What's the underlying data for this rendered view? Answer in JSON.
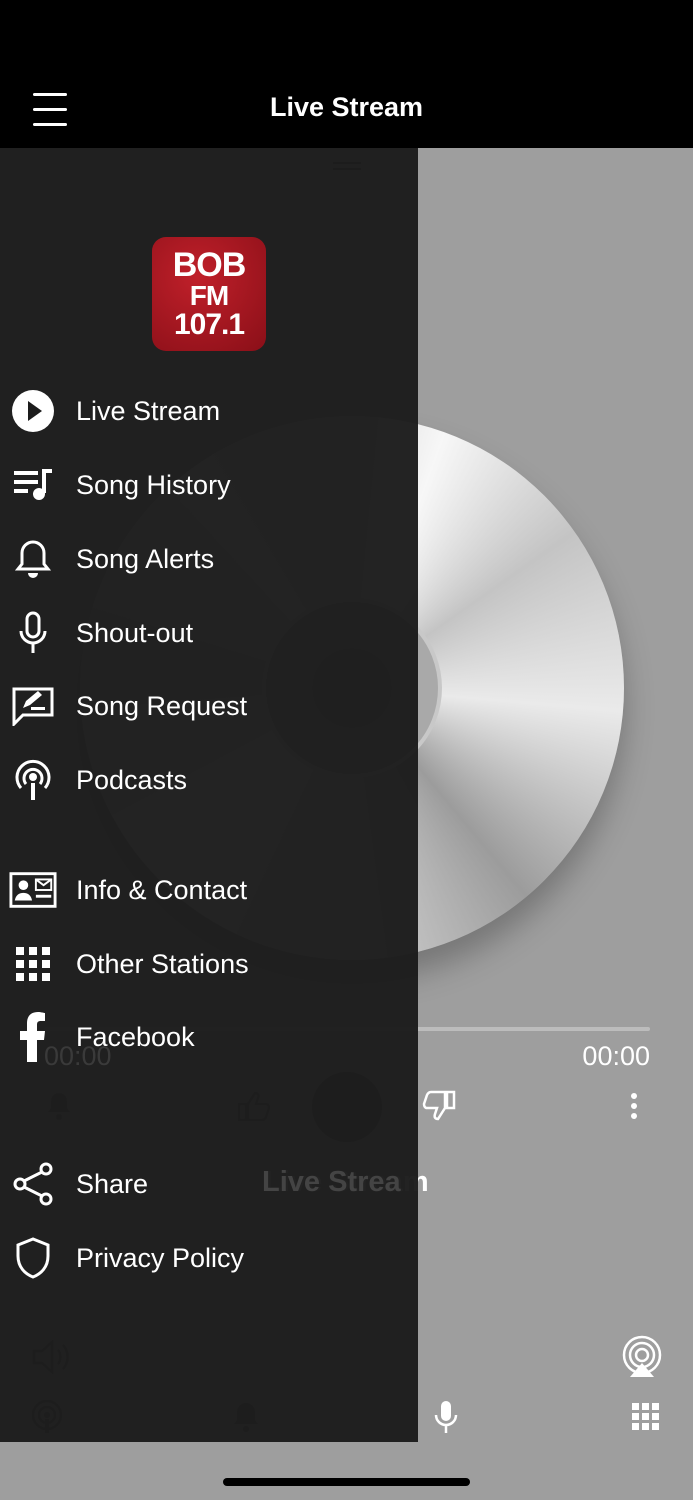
{
  "header": {
    "title": "Live Stream"
  },
  "player": {
    "elapsed": "00:00",
    "duration": "00:00",
    "title": "Live Stream",
    "progress": 0
  },
  "drawer": {
    "logo": {
      "line1": "BOB",
      "line2": "FM",
      "line3": "107.1"
    },
    "items": [
      {
        "label": "Live Stream",
        "icon": "play-circle-icon"
      },
      {
        "label": "Song History",
        "icon": "playlist-icon"
      },
      {
        "label": "Song Alerts",
        "icon": "bell-icon"
      },
      {
        "label": "Shout-out",
        "icon": "microphone-icon"
      },
      {
        "label": "Song Request",
        "icon": "request-icon"
      },
      {
        "label": "Podcasts",
        "icon": "podcast-icon"
      },
      {
        "label": "Info & Contact",
        "icon": "contact-card-icon"
      },
      {
        "label": "Other Stations",
        "icon": "grid-icon"
      },
      {
        "label": "Facebook",
        "icon": "facebook-icon"
      },
      {
        "label": "Share",
        "icon": "share-icon"
      },
      {
        "label": "Privacy Policy",
        "icon": "shield-icon"
      }
    ]
  },
  "colors": {
    "header_bg": "#000000",
    "drawer_bg": "#1c1c1c",
    "logo_red": "#a3161f",
    "content_bg": "#9e9e9e"
  }
}
